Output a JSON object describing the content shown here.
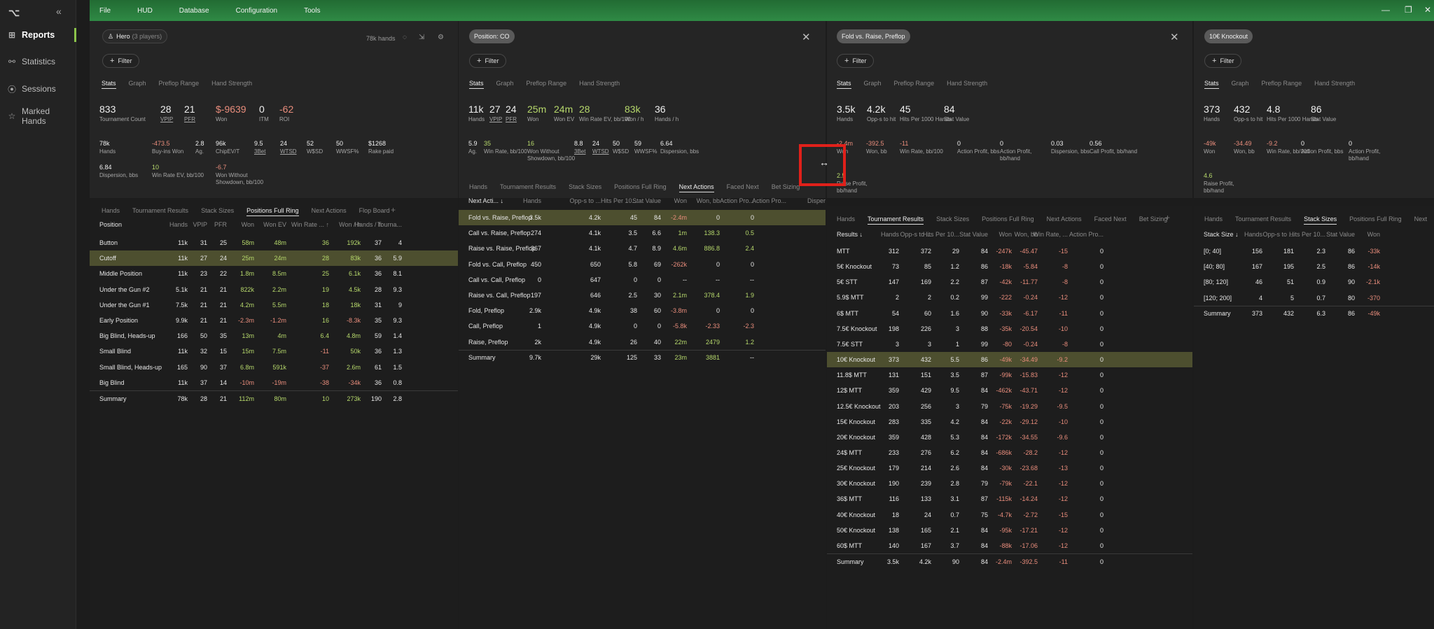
{
  "app": {
    "logo": "⌥",
    "collapse": "«"
  },
  "sidebar": {
    "items": [
      {
        "label": "Reports",
        "icon": "reports-icon",
        "glyph": "⊞",
        "active": true
      },
      {
        "label": "Statistics",
        "icon": "statistics-icon",
        "glyph": "⚯"
      },
      {
        "label": "Sessions",
        "icon": "sessions-icon",
        "glyph": "⦿"
      },
      {
        "label": "Marked Hands",
        "icon": "star-icon",
        "glyph": "☆"
      }
    ]
  },
  "menu": [
    "File",
    "HUD",
    "Database",
    "Configuration",
    "Tools"
  ],
  "window": {
    "minimize": "—",
    "restore": "❐",
    "close": "✕"
  },
  "panel1": {
    "chip": "Hero",
    "chip_sub": "(3 players)",
    "hands_info": "78k hands",
    "filter": "Filter",
    "tabs": [
      "Stats",
      "Graph",
      "Preflop Range",
      "Hand Strength"
    ],
    "big": [
      {
        "v": "833",
        "l": "Tournament Count"
      },
      {
        "v": "28",
        "l": "VPIP"
      },
      {
        "v": "21",
        "l": "PFR"
      },
      {
        "v": "$-9639",
        "l": "Won"
      },
      {
        "v": "0",
        "l": "ITM"
      },
      {
        "v": "-62",
        "l": "ROI"
      }
    ],
    "row2": [
      {
        "v": "78k",
        "l": "Hands"
      },
      {
        "v": "-473.5",
        "l": "Buy-ins Won"
      },
      {
        "v": "2.8",
        "l": "Ag."
      },
      {
        "v": "96k",
        "l": "ChipEV/T"
      },
      {
        "v": "9.5",
        "l": "3Bet"
      },
      {
        "v": "24",
        "l": "WTSD"
      },
      {
        "v": "52",
        "l": "W$SD"
      },
      {
        "v": "50",
        "l": "WWSF%"
      },
      {
        "v": "$1268",
        "l": "Rake paid"
      }
    ],
    "row3": [
      {
        "v": "6.84",
        "l": "Dispersion, bbs"
      },
      {
        "v": "10",
        "l": "Win Rate EV, bb/100"
      },
      {
        "v": "-6.7",
        "l": "Won Without Showdown, bb/100"
      }
    ],
    "btabs": [
      "Hands",
      "Tournament Results",
      "Stack Sizes",
      "Positions Full Ring",
      "Next Actions",
      "Flop Board"
    ],
    "header": [
      "Position",
      "Hands",
      "VPIP",
      "PFR",
      "Won",
      "Won EV",
      "Win Rate ... ↑",
      "Won / h",
      "Hands / h",
      "Tourna..."
    ],
    "rows": [
      [
        "Button",
        "11k",
        "31",
        "25",
        "58m",
        "48m",
        "36",
        "192k",
        "37",
        "4"
      ],
      [
        "Cutoff",
        "11k",
        "27",
        "24",
        "25m",
        "24m",
        "28",
        "83k",
        "36",
        "5.9"
      ],
      [
        "Middle Position",
        "11k",
        "23",
        "22",
        "1.8m",
        "8.5m",
        "25",
        "6.1k",
        "36",
        "8.1"
      ],
      [
        "Under the Gun #2",
        "5.1k",
        "21",
        "21",
        "822k",
        "2.2m",
        "19",
        "4.5k",
        "28",
        "9.3"
      ],
      [
        "Under the Gun #1",
        "7.5k",
        "21",
        "21",
        "4.2m",
        "5.5m",
        "18",
        "18k",
        "31",
        "9"
      ],
      [
        "Early Position",
        "9.9k",
        "21",
        "21",
        "-2.3m",
        "-1.2m",
        "16",
        "-8.3k",
        "35",
        "9.3"
      ],
      [
        "Big Blind, Heads-up",
        "166",
        "50",
        "35",
        "13m",
        "4m",
        "6.4",
        "4.8m",
        "59",
        "1.4"
      ],
      [
        "Small Blind",
        "11k",
        "32",
        "15",
        "15m",
        "7.5m",
        "-11",
        "50k",
        "36",
        "1.3"
      ],
      [
        "Small Blind, Heads-up",
        "165",
        "90",
        "37",
        "6.8m",
        "591k",
        "-37",
        "2.6m",
        "61",
        "1.5"
      ],
      [
        "Big Blind",
        "11k",
        "37",
        "14",
        "-10m",
        "-19m",
        "-38",
        "-34k",
        "36",
        "0.8"
      ],
      [
        "Summary",
        "78k",
        "28",
        "21",
        "112m",
        "80m",
        "10",
        "273k",
        "190",
        "2.8"
      ]
    ]
  },
  "panel2": {
    "chip": "Position: CO",
    "filter": "Filter",
    "close": "✕",
    "tabs": [
      "Stats",
      "Graph",
      "Preflop Range",
      "Hand Strength"
    ],
    "big": [
      {
        "v": "11k",
        "l": "Hands"
      },
      {
        "v": "27",
        "l": "VPIP"
      },
      {
        "v": "24",
        "l": "PFR"
      },
      {
        "v": "25m",
        "l": "Won"
      },
      {
        "v": "24m",
        "l": "Won EV"
      },
      {
        "v": "28",
        "l": "Win Rate EV, bb/100"
      },
      {
        "v": "83k",
        "l": "Won / h"
      },
      {
        "v": "36",
        "l": "Hands / h"
      }
    ],
    "row2": [
      {
        "v": "5.9",
        "l": "Ag."
      },
      {
        "v": "35",
        "l": "Win Rate, bb/100"
      },
      {
        "v": "16",
        "l": "Won Without Showdown, bb/100"
      },
      {
        "v": "8.8",
        "l": "3Bet"
      },
      {
        "v": "24",
        "l": "WTSD"
      },
      {
        "v": "50",
        "l": "W$SD"
      },
      {
        "v": "59",
        "l": "WWSF%"
      },
      {
        "v": "6.64",
        "l": "Dispersion, bbs"
      }
    ],
    "btabs": [
      "Hands",
      "Tournament Results",
      "Stack Sizes",
      "Positions Full Ring",
      "Next Actions",
      "Faced Next",
      "Bet Sizing"
    ],
    "header": [
      "Next Acti... ↓",
      "Hands",
      "Opp-s to ...",
      "Hits Per 10...",
      "Stat Value",
      "Won",
      "Won, bb",
      "Action Pro...",
      "Action Pro...",
      "Disper"
    ],
    "rows": [
      [
        "Fold vs. Raise, Preflop",
        "3.5k",
        "4.2k",
        "45",
        "84",
        "-2.4m",
        "0",
        "0",
        ""
      ],
      [
        "Call vs. Raise, Preflop",
        "274",
        "4.1k",
        "3.5",
        "6.6",
        "1m",
        "138.3",
        "0.5",
        ""
      ],
      [
        "Raise vs. Raise, Preflop",
        "367",
        "4.1k",
        "4.7",
        "8.9",
        "4.6m",
        "886.8",
        "2.4",
        ""
      ],
      [
        "Fold vs. Call, Preflop",
        "450",
        "650",
        "5.8",
        "69",
        "-262k",
        "0",
        "0",
        ""
      ],
      [
        "Call vs. Call, Preflop",
        "0",
        "647",
        "0",
        "0",
        "--",
        "--",
        "--",
        ""
      ],
      [
        "Raise vs. Call, Preflop",
        "197",
        "646",
        "2.5",
        "30",
        "2.1m",
        "378.4",
        "1.9",
        ""
      ],
      [
        "Fold, Preflop",
        "2.9k",
        "4.9k",
        "38",
        "60",
        "-3.8m",
        "0",
        "0",
        ""
      ],
      [
        "Call, Preflop",
        "1",
        "4.9k",
        "0",
        "0",
        "-5.8k",
        "-2.33",
        "-2.3",
        ""
      ],
      [
        "Raise, Preflop",
        "2k",
        "4.9k",
        "26",
        "40",
        "22m",
        "2479",
        "1.2",
        ""
      ],
      [
        "Summary",
        "9.7k",
        "29k",
        "125",
        "33",
        "23m",
        "3881",
        "--",
        ""
      ]
    ]
  },
  "panel3": {
    "chip": "Fold vs. Raise, Preflop",
    "filter": "Filter",
    "close": "✕",
    "tabs": [
      "Stats",
      "Graph",
      "Preflop Range",
      "Hand Strength"
    ],
    "big": [
      {
        "v": "3.5k",
        "l": "Hands"
      },
      {
        "v": "4.2k",
        "l": "Opp-s to hit"
      },
      {
        "v": "45",
        "l": "Hits Per 1000 Hands"
      },
      {
        "v": "84",
        "l": "Stat Value"
      }
    ],
    "row2": [
      {
        "v": "-2.4m",
        "l": "Won"
      },
      {
        "v": "-392.5",
        "l": "Won, bb"
      },
      {
        "v": "-11",
        "l": "Win Rate, bb/100"
      },
      {
        "v": "0",
        "l": "Action Profit, bbs"
      },
      {
        "v": "0",
        "l": "Action Profit, bb/hand"
      },
      {
        "v": "0.03",
        "l": "Dispersion, bbs"
      },
      {
        "v": "0.56",
        "l": "Call Profit, bb/hand"
      }
    ],
    "row3": [
      {
        "v": "2.5",
        "l": "Raise Profit, bb/hand"
      }
    ],
    "btabs": [
      "Hands",
      "Tournament Results",
      "Stack Sizes",
      "Positions Full Ring",
      "Next Actions",
      "Faced Next",
      "Bet Sizing"
    ],
    "header": [
      "Results ↓",
      "Hands",
      "Opp-s to ...",
      "Hits Per 10...",
      "Stat Value",
      "Won",
      "Won, bb",
      "Win Rate, ...",
      "Action Pro..."
    ],
    "rows": [
      [
        "MTT",
        "312",
        "372",
        "29",
        "84",
        "-247k",
        "-45.47",
        "-15",
        "0"
      ],
      [
        "5€ Knockout",
        "73",
        "85",
        "1.2",
        "86",
        "-18k",
        "-5.84",
        "-8",
        "0"
      ],
      [
        "5€ STT",
        "147",
        "169",
        "2.2",
        "87",
        "-42k",
        "-11.77",
        "-8",
        "0"
      ],
      [
        "5.9$ MTT",
        "2",
        "2",
        "0.2",
        "99",
        "-222",
        "-0.24",
        "-12",
        "0"
      ],
      [
        "6$ MTT",
        "54",
        "60",
        "1.6",
        "90",
        "-33k",
        "-6.17",
        "-11",
        "0"
      ],
      [
        "7.5€ Knockout",
        "198",
        "226",
        "3",
        "88",
        "-35k",
        "-20.54",
        "-10",
        "0"
      ],
      [
        "7.5€ STT",
        "3",
        "3",
        "1",
        "99",
        "-80",
        "-0.24",
        "-8",
        "0"
      ],
      [
        "10€ Knockout",
        "373",
        "432",
        "5.5",
        "86",
        "-49k",
        "-34.49",
        "-9.2",
        "0"
      ],
      [
        "11.8$ MTT",
        "131",
        "151",
        "3.5",
        "87",
        "-99k",
        "-15.83",
        "-12",
        "0"
      ],
      [
        "12$ MTT",
        "359",
        "429",
        "9.5",
        "84",
        "-462k",
        "-43.71",
        "-12",
        "0"
      ],
      [
        "12.5€ Knockout",
        "203",
        "256",
        "3",
        "79",
        "-75k",
        "-19.29",
        "-9.5",
        "0"
      ],
      [
        "15€ Knockout",
        "283",
        "335",
        "4.2",
        "84",
        "-22k",
        "-29.12",
        "-10",
        "0"
      ],
      [
        "20€ Knockout",
        "359",
        "428",
        "5.3",
        "84",
        "-172k",
        "-34.55",
        "-9.6",
        "0"
      ],
      [
        "24$ MTT",
        "233",
        "276",
        "6.2",
        "84",
        "-686k",
        "-28.2",
        "-12",
        "0"
      ],
      [
        "25€ Knockout",
        "179",
        "214",
        "2.6",
        "84",
        "-30k",
        "-23.68",
        "-13",
        "0"
      ],
      [
        "30€ Knockout",
        "190",
        "239",
        "2.8",
        "79",
        "-79k",
        "-22.1",
        "-12",
        "0"
      ],
      [
        "36$ MTT",
        "116",
        "133",
        "3.1",
        "87",
        "-115k",
        "-14.24",
        "-12",
        "0"
      ],
      [
        "40€ Knockout",
        "18",
        "24",
        "0.7",
        "75",
        "-4.7k",
        "-2.72",
        "-15",
        "0"
      ],
      [
        "50€ Knockout",
        "138",
        "165",
        "2.1",
        "84",
        "-95k",
        "-17.21",
        "-12",
        "0"
      ],
      [
        "60$ MTT",
        "140",
        "167",
        "3.7",
        "84",
        "-88k",
        "-17.06",
        "-12",
        "0"
      ],
      [
        "Summary",
        "3.5k",
        "4.2k",
        "90",
        "84",
        "-2.4m",
        "-392.5",
        "-11",
        "0"
      ]
    ]
  },
  "panel4": {
    "chip": "10€ Knockout",
    "filter": "Filter",
    "tabs": [
      "Stats",
      "Graph",
      "Preflop Range",
      "Hand Strength"
    ],
    "big": [
      {
        "v": "373",
        "l": "Hands"
      },
      {
        "v": "432",
        "l": "Opp-s to hit"
      },
      {
        "v": "4.8",
        "l": "Hits Per 1000 Hands"
      },
      {
        "v": "86",
        "l": "Stat Value"
      }
    ],
    "row2": [
      {
        "v": "-49k",
        "l": "Won"
      },
      {
        "v": "-34.49",
        "l": "Won, bb"
      },
      {
        "v": "-9.2",
        "l": "Win Rate, bb/100"
      },
      {
        "v": "0",
        "l": "Action Profit, bbs"
      },
      {
        "v": "0",
        "l": "Action Profit, bb/hand"
      }
    ],
    "row3": [
      {
        "v": "4.6",
        "l": "Raise Profit, bb/hand"
      }
    ],
    "btabs": [
      "Hands",
      "Tournament Results",
      "Stack Sizes",
      "Positions Full Ring",
      "Next"
    ],
    "header": [
      "Stack Size ↓",
      "Hands",
      "Opp-s to ...",
      "Hits Per 10...",
      "Stat Value",
      "Won"
    ],
    "rows": [
      [
        "[0; 40]",
        "156",
        "181",
        "2.3",
        "86",
        "-33k"
      ],
      [
        "[40; 80]",
        "167",
        "195",
        "2.5",
        "86",
        "-14k"
      ],
      [
        "[80; 120]",
        "46",
        "51",
        "0.9",
        "90",
        "-2.1k"
      ],
      [
        "[120; 200]",
        "4",
        "5",
        "0.7",
        "80",
        "-370"
      ],
      [
        "Summary",
        "373",
        "432",
        "6.3",
        "86",
        "-49k"
      ]
    ]
  },
  "cursor": {
    "glyph": "↔"
  }
}
